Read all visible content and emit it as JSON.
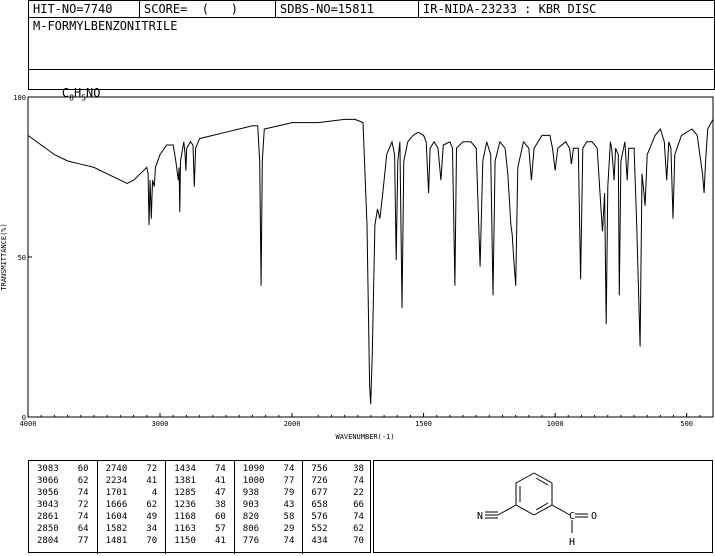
{
  "header": {
    "hit_no": "HIT-NO=7740",
    "score": "SCORE=  (   )",
    "sdbs_no": "SDBS-NO=15811",
    "ir_nida": "IR-NIDA-23233 : KBR DISC"
  },
  "compound": {
    "name": "M-FORMYLBENZONITRILE",
    "formula_parts": [
      "C",
      "8",
      "H",
      "5",
      "NO"
    ]
  },
  "chart_data": {
    "type": "line",
    "xlabel": "WAVENUMBER(-1)",
    "ylabel": "TRANSMITTANCE(%)",
    "xlim": [
      4000,
      400
    ],
    "ylim": [
      0,
      100
    ],
    "x_ticks": [
      4000,
      3000,
      2000,
      1500,
      1000,
      500
    ],
    "y_ticks": [
      0,
      50,
      100
    ],
    "series": [
      {
        "points": [
          [
            4000,
            88
          ],
          [
            3900,
            85
          ],
          [
            3800,
            82
          ],
          [
            3700,
            80
          ],
          [
            3600,
            79
          ],
          [
            3500,
            78
          ],
          [
            3400,
            76
          ],
          [
            3300,
            74
          ],
          [
            3250,
            73
          ],
          [
            3200,
            74
          ],
          [
            3150,
            76
          ],
          [
            3100,
            78
          ],
          [
            3090,
            76
          ],
          [
            3083,
            60
          ],
          [
            3075,
            74
          ],
          [
            3066,
            62
          ],
          [
            3060,
            70
          ],
          [
            3056,
            74
          ],
          [
            3050,
            73
          ],
          [
            3043,
            72
          ],
          [
            3035,
            78
          ],
          [
            3000,
            82
          ],
          [
            2950,
            85
          ],
          [
            2900,
            85
          ],
          [
            2880,
            80
          ],
          [
            2861,
            74
          ],
          [
            2855,
            78
          ],
          [
            2850,
            64
          ],
          [
            2845,
            80
          ],
          [
            2820,
            86
          ],
          [
            2810,
            82
          ],
          [
            2804,
            77
          ],
          [
            2798,
            84
          ],
          [
            2770,
            86
          ],
          [
            2750,
            85
          ],
          [
            2740,
            72
          ],
          [
            2730,
            84
          ],
          [
            2700,
            87
          ],
          [
            2600,
            88
          ],
          [
            2500,
            89
          ],
          [
            2400,
            90
          ],
          [
            2300,
            91
          ],
          [
            2260,
            91
          ],
          [
            2245,
            80
          ],
          [
            2234,
            41
          ],
          [
            2225,
            80
          ],
          [
            2210,
            90
          ],
          [
            2100,
            91
          ],
          [
            2000,
            92
          ],
          [
            1900,
            92
          ],
          [
            1800,
            93
          ],
          [
            1760,
            93
          ],
          [
            1730,
            92
          ],
          [
            1715,
            60
          ],
          [
            1705,
            10
          ],
          [
            1701,
            4
          ],
          [
            1695,
            20
          ],
          [
            1685,
            60
          ],
          [
            1675,
            65
          ],
          [
            1666,
            62
          ],
          [
            1655,
            70
          ],
          [
            1640,
            82
          ],
          [
            1620,
            86
          ],
          [
            1610,
            82
          ],
          [
            1604,
            49
          ],
          [
            1598,
            80
          ],
          [
            1590,
            86
          ],
          [
            1582,
            34
          ],
          [
            1575,
            80
          ],
          [
            1560,
            86
          ],
          [
            1540,
            88
          ],
          [
            1520,
            89
          ],
          [
            1500,
            88
          ],
          [
            1490,
            86
          ],
          [
            1481,
            70
          ],
          [
            1475,
            84
          ],
          [
            1460,
            86
          ],
          [
            1445,
            84
          ],
          [
            1434,
            74
          ],
          [
            1425,
            85
          ],
          [
            1400,
            86
          ],
          [
            1390,
            84
          ],
          [
            1381,
            41
          ],
          [
            1375,
            84
          ],
          [
            1350,
            86
          ],
          [
            1320,
            86
          ],
          [
            1300,
            84
          ],
          [
            1285,
            47
          ],
          [
            1275,
            80
          ],
          [
            1260,
            86
          ],
          [
            1245,
            82
          ],
          [
            1236,
            38
          ],
          [
            1228,
            80
          ],
          [
            1210,
            86
          ],
          [
            1190,
            84
          ],
          [
            1180,
            76
          ],
          [
            1168,
            60
          ],
          [
            1163,
            57
          ],
          [
            1158,
            50
          ],
          [
            1150,
            41
          ],
          [
            1142,
            78
          ],
          [
            1120,
            86
          ],
          [
            1100,
            84
          ],
          [
            1090,
            74
          ],
          [
            1080,
            84
          ],
          [
            1050,
            88
          ],
          [
            1020,
            88
          ],
          [
            1010,
            84
          ],
          [
            1000,
            77
          ],
          [
            990,
            84
          ],
          [
            960,
            86
          ],
          [
            945,
            84
          ],
          [
            938,
            79
          ],
          [
            930,
            84
          ],
          [
            912,
            84
          ],
          [
            903,
            43
          ],
          [
            895,
            84
          ],
          [
            880,
            86
          ],
          [
            860,
            86
          ],
          [
            840,
            84
          ],
          [
            825,
            64
          ],
          [
            820,
            58
          ],
          [
            812,
            70
          ],
          [
            806,
            29
          ],
          [
            800,
            72
          ],
          [
            790,
            86
          ],
          [
            785,
            84
          ],
          [
            776,
            74
          ],
          [
            770,
            84
          ],
          [
            760,
            82
          ],
          [
            756,
            38
          ],
          [
            750,
            80
          ],
          [
            735,
            86
          ],
          [
            726,
            74
          ],
          [
            720,
            84
          ],
          [
            700,
            84
          ],
          [
            690,
            60
          ],
          [
            677,
            22
          ],
          [
            670,
            76
          ],
          [
            665,
            72
          ],
          [
            658,
            66
          ],
          [
            650,
            82
          ],
          [
            620,
            88
          ],
          [
            600,
            90
          ],
          [
            585,
            86
          ],
          [
            576,
            74
          ],
          [
            568,
            86
          ],
          [
            560,
            84
          ],
          [
            552,
            62
          ],
          [
            545,
            82
          ],
          [
            520,
            88
          ],
          [
            500,
            89
          ],
          [
            480,
            90
          ],
          [
            460,
            88
          ],
          [
            440,
            76
          ],
          [
            434,
            70
          ],
          [
            428,
            80
          ],
          [
            420,
            90
          ],
          [
            400,
            93
          ]
        ]
      }
    ]
  },
  "peak_table": {
    "columns": [
      [
        [
          "3083",
          "60"
        ],
        [
          "3066",
          "62"
        ],
        [
          "3056",
          "74"
        ],
        [
          "3043",
          "72"
        ],
        [
          "2861",
          "74"
        ],
        [
          "2850",
          "64"
        ],
        [
          "2804",
          "77"
        ]
      ],
      [
        [
          "2740",
          "72"
        ],
        [
          "2234",
          "41"
        ],
        [
          "1701",
          "4"
        ],
        [
          "1666",
          "62"
        ],
        [
          "1604",
          "49"
        ],
        [
          "1582",
          "34"
        ],
        [
          "1481",
          "70"
        ]
      ],
      [
        [
          "1434",
          "74"
        ],
        [
          "1381",
          "41"
        ],
        [
          "1285",
          "47"
        ],
        [
          "1236",
          "38"
        ],
        [
          "1168",
          "60"
        ],
        [
          "1163",
          "57"
        ],
        [
          "1150",
          "41"
        ]
      ],
      [
        [
          "1090",
          "74"
        ],
        [
          "1000",
          "77"
        ],
        [
          "938",
          "79"
        ],
        [
          "903",
          "43"
        ],
        [
          "820",
          "58"
        ],
        [
          "806",
          "29"
        ],
        [
          "776",
          "74"
        ]
      ],
      [
        [
          "756",
          "38"
        ],
        [
          "726",
          "74"
        ],
        [
          "677",
          "22"
        ],
        [
          "658",
          "66"
        ],
        [
          "576",
          "74"
        ],
        [
          "552",
          "62"
        ],
        [
          "434",
          "70"
        ]
      ]
    ]
  },
  "structure": {
    "nitrile_label": "N",
    "carbonyl_carbon": "C",
    "oxygen": "O",
    "hydrogen": "H"
  }
}
